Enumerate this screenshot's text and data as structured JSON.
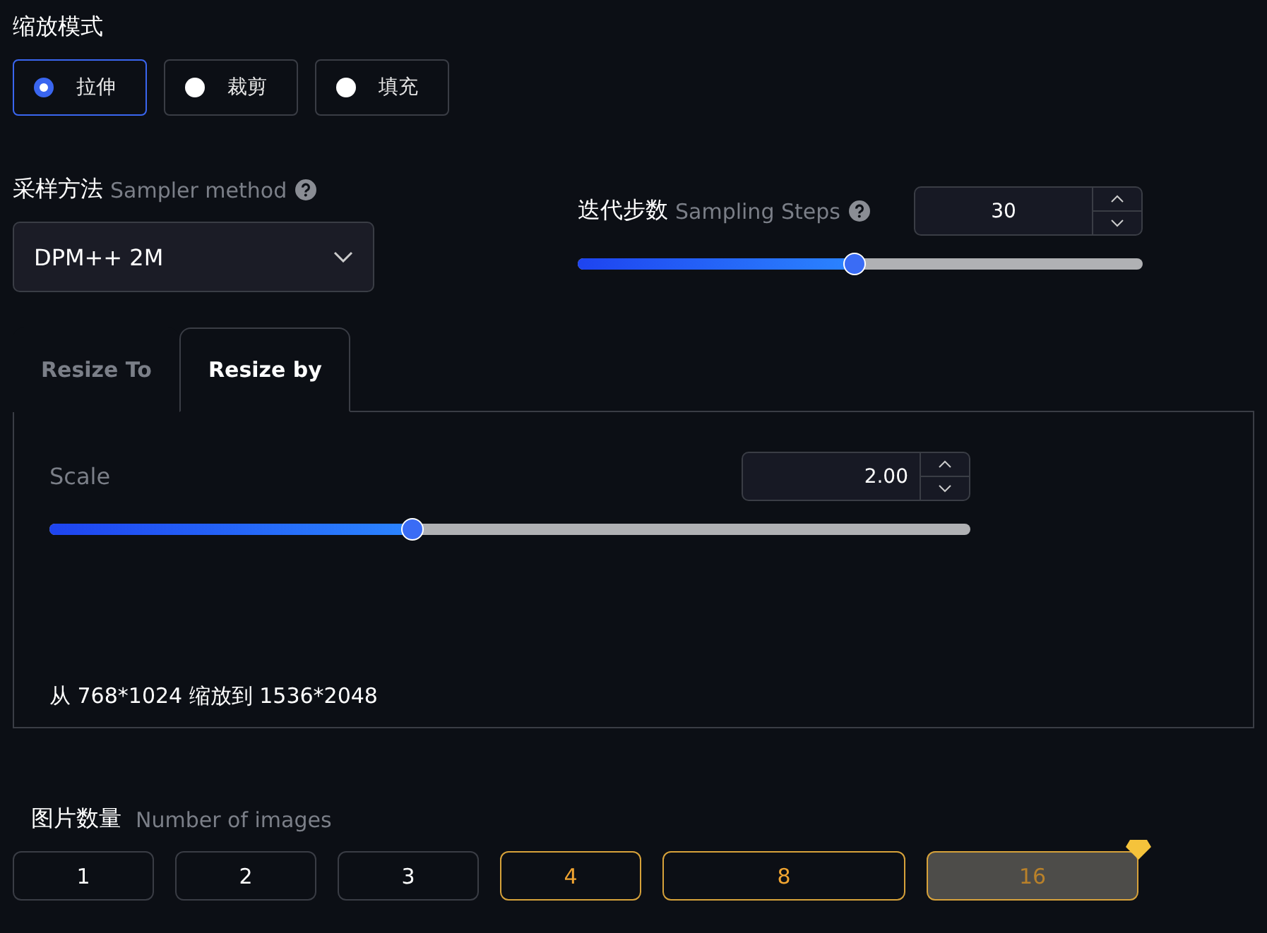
{
  "scale_mode": {
    "title": "缩放模式",
    "options": [
      {
        "label": "拉伸",
        "selected": true
      },
      {
        "label": "裁剪",
        "selected": false
      },
      {
        "label": "填充",
        "selected": false
      }
    ]
  },
  "sampler": {
    "title": "采样方法",
    "subtitle": "Sampler method",
    "value": "DPM++ 2M"
  },
  "steps": {
    "title": "迭代步数",
    "subtitle": "Sampling Steps",
    "value": "30",
    "level": 0.49
  },
  "tabs": [
    {
      "label": "Resize To",
      "selected": false
    },
    {
      "label": "Resize by",
      "selected": true
    }
  ],
  "scale": {
    "label": "Scale",
    "value": "2.00",
    "level": 0.394,
    "summary": "从 768*1024 缩放到 1536*2048"
  },
  "images": {
    "title": "图片数量",
    "subtitle": "Number of images",
    "options": [
      {
        "label": "1",
        "kind": "standard",
        "locked": false
      },
      {
        "label": "2",
        "kind": "standard",
        "locked": false
      },
      {
        "label": "3",
        "kind": "standard",
        "locked": false
      },
      {
        "label": "4",
        "kind": "premium",
        "locked": false
      },
      {
        "label": "8",
        "kind": "premium",
        "locked": false
      },
      {
        "label": "16",
        "kind": "premium",
        "locked": true
      }
    ]
  }
}
